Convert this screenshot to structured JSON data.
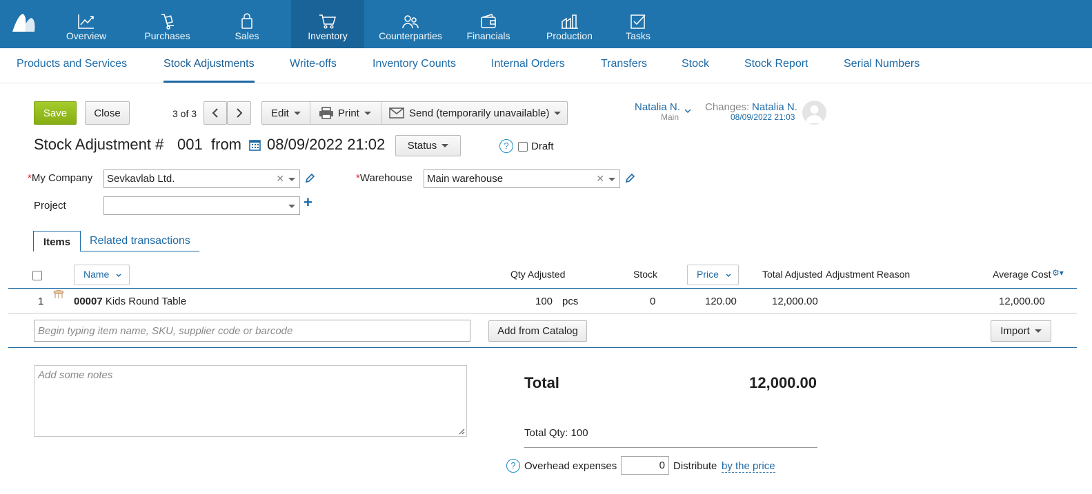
{
  "topnav": {
    "items": [
      {
        "label": "Overview",
        "icon": "chart-line-icon"
      },
      {
        "label": "Purchases",
        "icon": "hand-truck-icon"
      },
      {
        "label": "Sales",
        "icon": "shopping-bag-icon"
      },
      {
        "label": "Inventory",
        "icon": "cart-icon",
        "active": true
      },
      {
        "label": "Counterparties",
        "icon": "people-icon"
      },
      {
        "label": "Financials",
        "icon": "wallet-icon"
      },
      {
        "label": "Production",
        "icon": "factory-icon"
      },
      {
        "label": "Tasks",
        "icon": "checkbox-icon"
      }
    ],
    "color": "#1f74ad",
    "active_color": "#1a6399"
  },
  "subnav": {
    "items": [
      {
        "label": "Products and Services"
      },
      {
        "label": "Stock Adjustments",
        "active": true
      },
      {
        "label": "Write-offs"
      },
      {
        "label": "Inventory Counts"
      },
      {
        "label": "Internal Orders"
      },
      {
        "label": "Transfers"
      },
      {
        "label": "Stock"
      },
      {
        "label": "Stock Report"
      },
      {
        "label": "Serial Numbers"
      }
    ]
  },
  "toolbar": {
    "save_label": "Save",
    "close_label": "Close",
    "pager": "3 of 3",
    "edit_label": "Edit",
    "print_label": "Print",
    "send_label": "Send (temporarily unavailable)"
  },
  "owner": {
    "name": "Natalia N.",
    "group": "Main",
    "changes_label": "Changes:",
    "changes_by": "Natalia N.",
    "changes_date": "08/09/2022 21:03"
  },
  "document": {
    "title_prefix": "Stock Adjustment #",
    "number": "001",
    "from_label": "from",
    "datetime": "08/09/2022 21:02",
    "status_label": "Status",
    "help_glyph": "?",
    "draft_label": "Draft"
  },
  "fields": {
    "company_label": "My Company",
    "company_value": "Sevkavlab Ltd.",
    "warehouse_label": "Warehouse",
    "warehouse_value": "Main warehouse",
    "project_label": "Project",
    "project_value": "",
    "required_mark": "*",
    "clear_glyph": "✕",
    "add_glyph": "+"
  },
  "tabs": {
    "items_label": "Items",
    "related_label": "Related transactions"
  },
  "table": {
    "headers": {
      "name": "Name",
      "qty": "Qty Adjusted",
      "stock": "Stock",
      "price": "Price",
      "total": "Total Adjusted",
      "reason": "Adjustment Reason",
      "avg_cost": "Average Cost"
    },
    "rows": [
      {
        "index": "1",
        "sku": "00007",
        "name": "Kids Round Table",
        "qty": "100",
        "unit": "pcs",
        "stock": "0",
        "price": "120.00",
        "total": "12,000.00",
        "reason": "",
        "avg_cost": "12,000.00"
      }
    ],
    "search_placeholder": "Begin typing item name, SKU, supplier code or barcode",
    "add_from_catalog": "Add from Catalog",
    "import_label": "Import"
  },
  "notes": {
    "placeholder": "Add some notes"
  },
  "totals": {
    "total_label": "Total",
    "total_value": "12,000.00",
    "qty_line": "Total Qty: 100",
    "overhead_label": "Overhead expenses",
    "overhead_value": "0",
    "distribute_label": "Distribute",
    "distribute_method": "by the price"
  },
  "colors": {
    "accent": "#1d6aa6",
    "save_green": "#92b91b",
    "required": "#d9242a"
  }
}
